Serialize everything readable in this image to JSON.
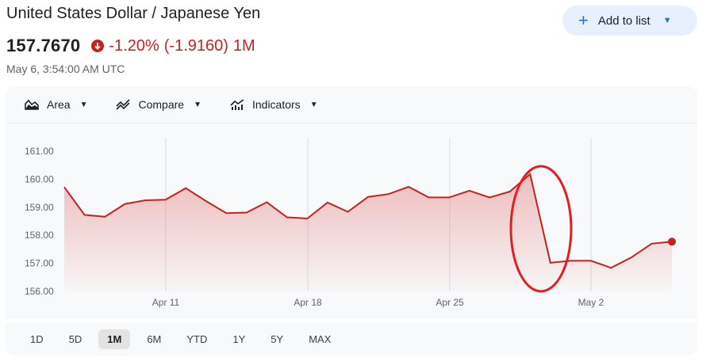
{
  "header": {
    "title": "United States Dollar / Japanese Yen",
    "price": "157.7670",
    "change_percent": "-1.20%",
    "change_absolute": "(-1.9160)",
    "change_period": "1M",
    "timestamp": "May 6, 3:54:00 AM UTC",
    "down_color": "#c5221f"
  },
  "add_button": {
    "label": "Add to list",
    "icon": "plus-icon"
  },
  "toolbar": {
    "items": [
      {
        "label": "Area",
        "icon": "area-chart-icon"
      },
      {
        "label": "Compare",
        "icon": "compare-icon"
      },
      {
        "label": "Indicators",
        "icon": "indicators-icon"
      }
    ]
  },
  "ranges": {
    "items": [
      "1D",
      "5D",
      "1M",
      "6M",
      "YTD",
      "1Y",
      "5Y",
      "MAX"
    ],
    "active": "1M"
  },
  "annotation": {
    "type": "hand-drawn red ellipse",
    "color": "#e02020"
  },
  "chart_data": {
    "type": "area",
    "series": [
      {
        "values": [
          159.72,
          158.73,
          158.66,
          159.12,
          159.25,
          159.27,
          159.68,
          159.22,
          158.79,
          158.81,
          159.18,
          158.64,
          158.6,
          159.17,
          158.84,
          159.37,
          159.47,
          159.73,
          159.35,
          159.35,
          159.59,
          159.35,
          159.56,
          160.18,
          157.02,
          157.09,
          157.09,
          156.84,
          157.21,
          157.7,
          157.77
        ]
      }
    ],
    "x_ticks": [
      "Apr 11",
      "Apr 18",
      "Apr 25",
      "May 2"
    ],
    "y_ticks": [
      "161.00",
      "160.00",
      "159.00",
      "158.00",
      "157.00",
      "156.00"
    ],
    "ylim": [
      156.0,
      161.0
    ],
    "grid": "vertical lines at x ticks",
    "line_color": "#c5221f"
  }
}
